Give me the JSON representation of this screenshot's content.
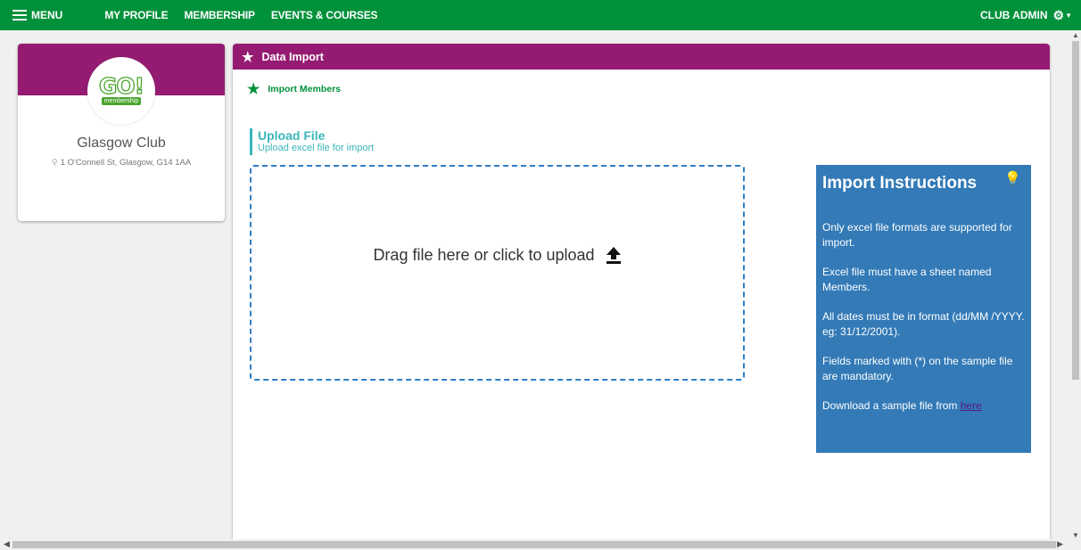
{
  "nav": {
    "menu_label": "MENU",
    "links": [
      "MY PROFILE",
      "MEMBERSHIP",
      "EVENTS & COURSES"
    ],
    "user_label": "CLUB ADMIN"
  },
  "profile": {
    "logo_text": "GO!",
    "logo_sub": "membership",
    "club_name": "Glasgow Club",
    "address": "1 O'Connell St, Glasgow, G14 1AA"
  },
  "panel": {
    "title": "Data Import",
    "sub_link": "Import Members",
    "upload_title": "Upload File",
    "upload_subtitle": "Upload excel file for import",
    "dropzone_text": "Drag file here or click to upload"
  },
  "instructions": {
    "title": "Import Instructions",
    "p1": "Only excel file formats are supported for import.",
    "p2": "Excel file must have a sheet named Members.",
    "p3": "All dates must be in format (dd/MM /YYYY. eg: 31/12/2001).",
    "p4": "Fields marked with (*) on the sample file are mandatory.",
    "p5_prefix": "Download a sample file from ",
    "p5_link": "here"
  },
  "colors": {
    "nav_green": "#00913a",
    "purple": "#951b72",
    "teal": "#3bb6ba",
    "blue": "#337ab7"
  }
}
